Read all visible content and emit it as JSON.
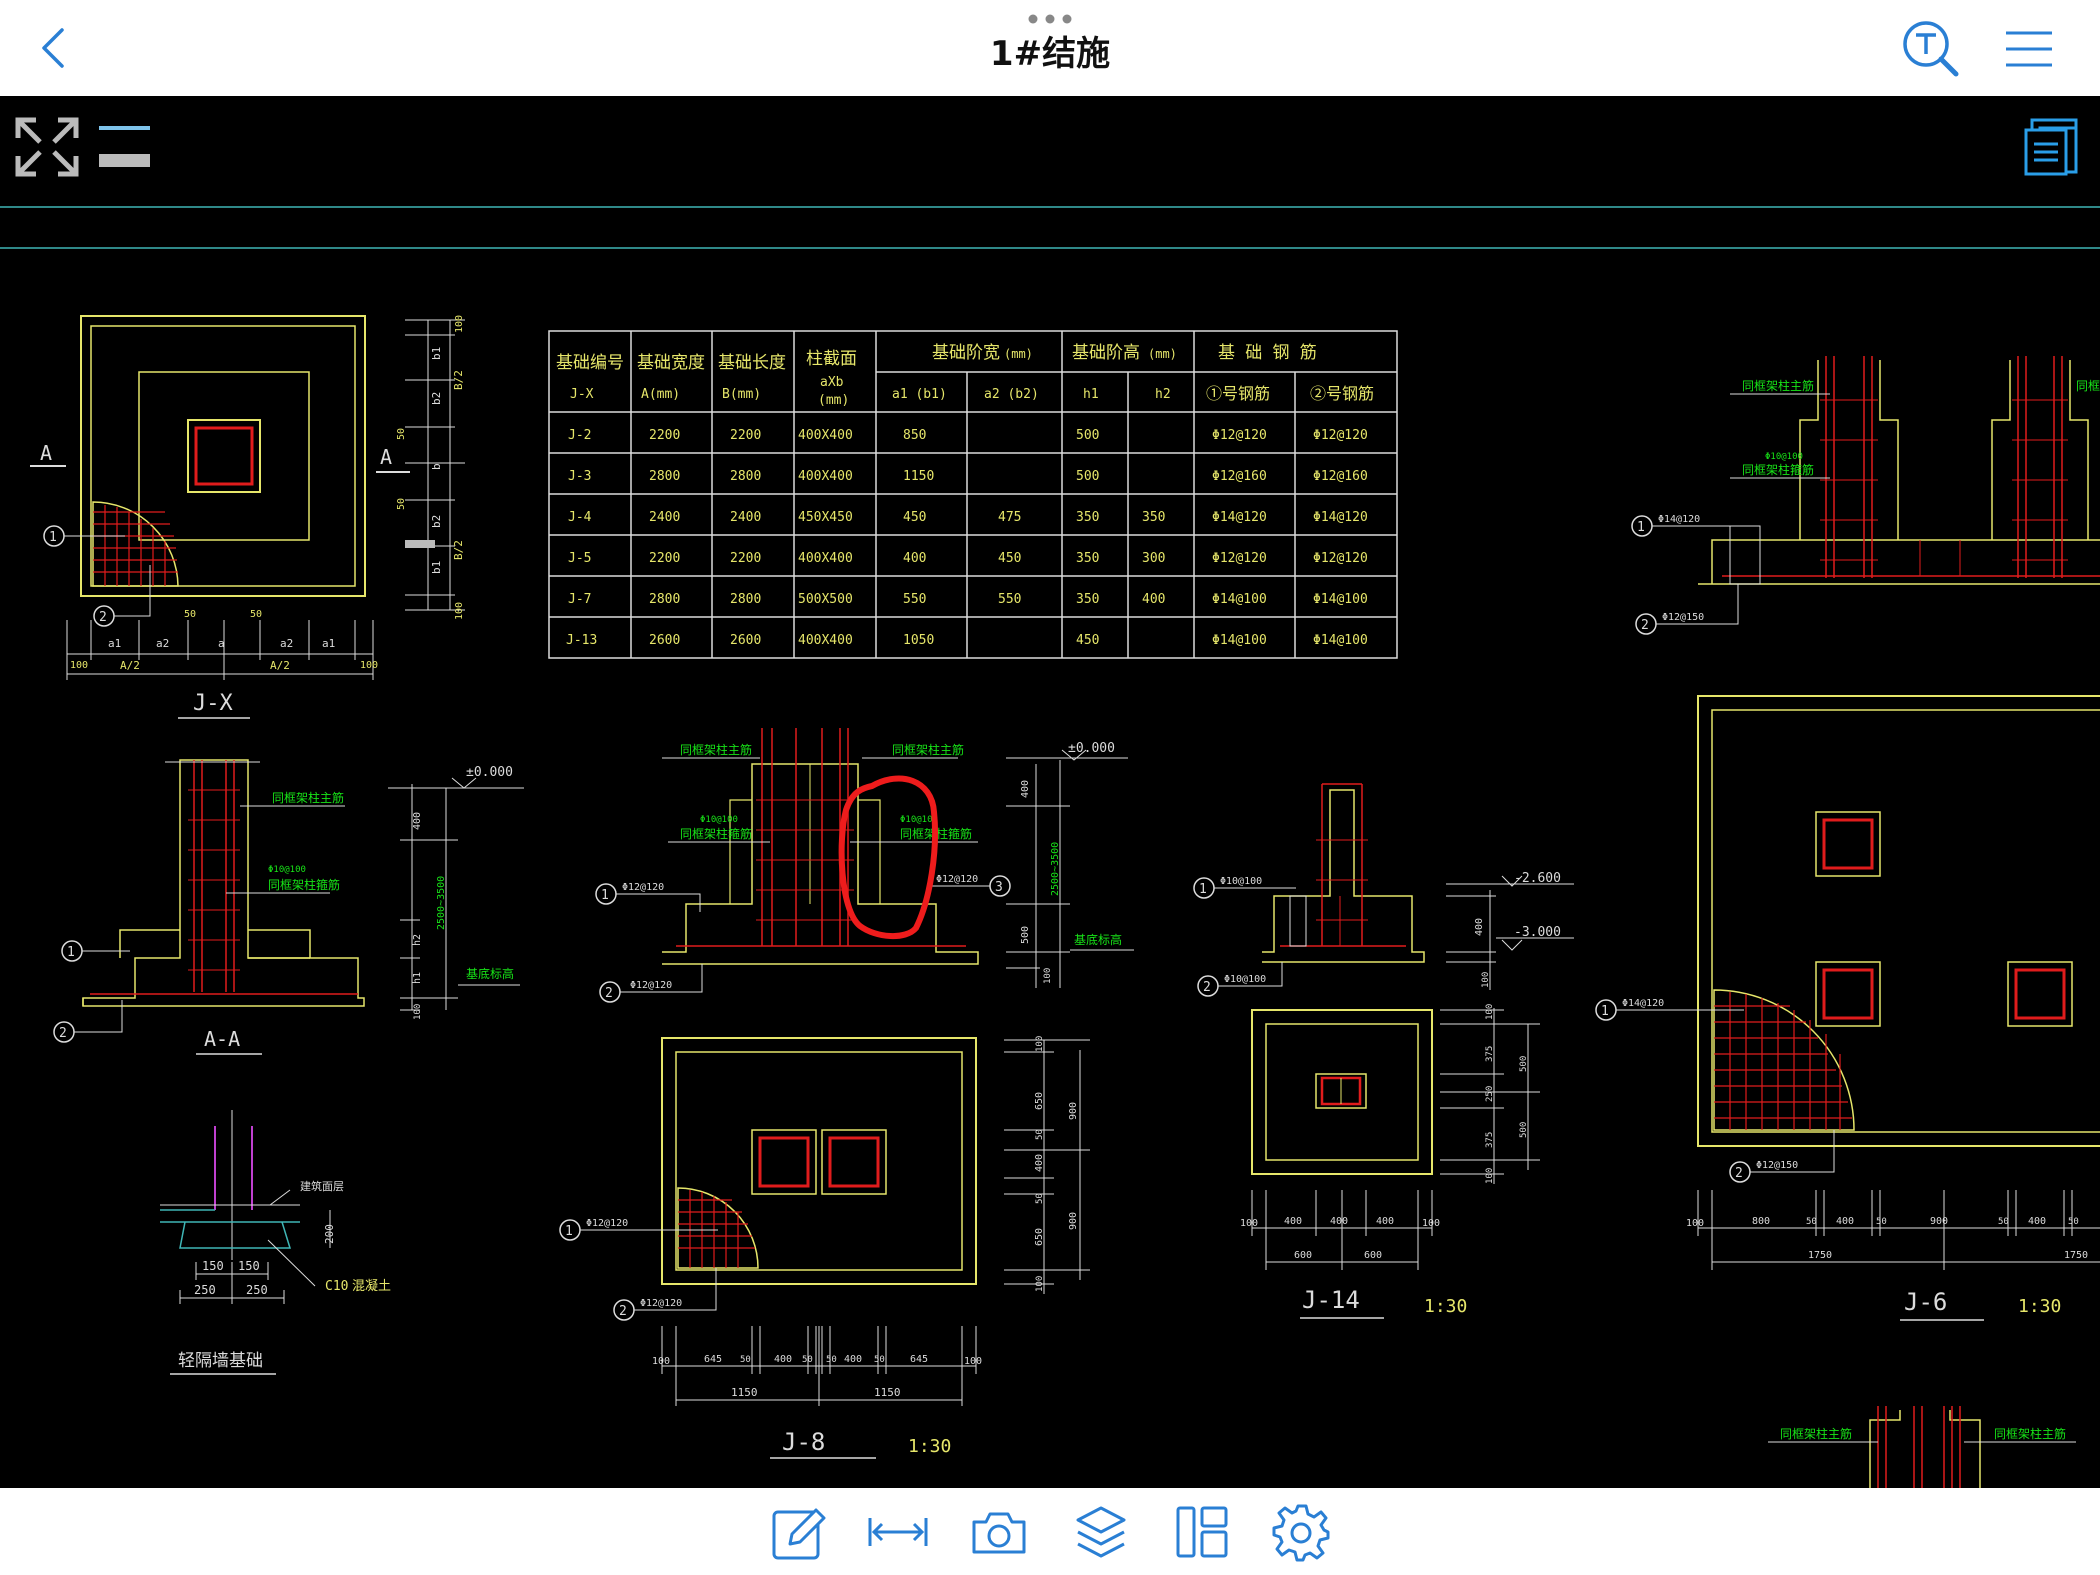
{
  "header": {
    "title": "1#结施"
  },
  "table": {
    "headers": [
      "基础编号",
      "基础宽度",
      "基础长度",
      "柱截面",
      "基础阶宽",
      "(mm)",
      "基础阶高",
      "(mm)",
      "基 础 钢 筋"
    ],
    "sub": [
      "J-X",
      "A(mm)",
      "B(mm)",
      "aXb",
      "(mm)",
      "a1 (b1)",
      "a2 (b2)",
      "h1",
      "h2",
      "①号钢筋",
      "②号钢筋"
    ],
    "rows": [
      [
        "J-2",
        "2200",
        "2200",
        "400X400",
        "850",
        "",
        "500",
        "",
        "Φ12@120",
        "Φ12@120"
      ],
      [
        "J-3",
        "2800",
        "2800",
        "400X400",
        "1150",
        "",
        "500",
        "",
        "Φ12@160",
        "Φ12@160"
      ],
      [
        "J-4",
        "2400",
        "2400",
        "450X450",
        "450",
        "475",
        "350",
        "350",
        "Φ14@120",
        "Φ14@120"
      ],
      [
        "J-5",
        "2200",
        "2200",
        "400X400",
        "400",
        "450",
        "350",
        "300",
        "Φ12@120",
        "Φ12@120"
      ],
      [
        "J-7",
        "2800",
        "2800",
        "500X500",
        "550",
        "550",
        "350",
        "400",
        "Φ14@100",
        "Φ14@100"
      ],
      [
        "J-13",
        "2600",
        "2600",
        "400X400",
        "1050",
        "",
        "450",
        "",
        "Φ14@100",
        "Φ14@100"
      ]
    ]
  },
  "labels": {
    "jx": "J-X",
    "aa": "A-A",
    "sec_a": "A",
    "light_wall": "轻隔墙基础",
    "j8": "J-8",
    "j14": "J-14",
    "j6": "J-6",
    "scale": "1:30",
    "c10": "C10",
    "concrete": "混凝土",
    "ground": "建筑面层",
    "col_main": "同框架柱主筋",
    "col_stir": "同框架柱箍筋",
    "base_level": "基底标高",
    "pm0": "±0.000",
    "m2600": "-2.600",
    "m3000": "-3.000",
    "r1": "Φ12@120",
    "r2": "Φ12@150",
    "r3": "Φ10@100",
    "r4": "Φ14@120",
    "dim_a2": "A/2",
    "dim_b2": "B/2",
    "range": "2500~3500",
    "a1": "a1",
    "a2": "a2",
    "a": "a",
    "b": "b",
    "b1": "b1",
    "b2": "b2",
    "h1": "h1",
    "h2": "h2",
    "j8_dims": [
      "100",
      "645",
      "50",
      "400",
      "50",
      "50",
      "400",
      "50",
      "645",
      "100"
    ],
    "j8_tot": [
      "1150",
      "1150"
    ],
    "j14_dims": [
      "100",
      "400",
      "400",
      "400",
      "100"
    ],
    "j14_tot": [
      "600",
      "600"
    ],
    "j6_dims": [
      "100",
      "800",
      "50",
      "400",
      "50",
      "900",
      "50",
      "400",
      "50"
    ],
    "j6_tot": [
      "1750",
      "1750"
    ],
    "lw_dims": [
      "150",
      "150",
      "250",
      "250",
      "200"
    ]
  },
  "colors": {
    "yellow": "#e6e66a",
    "green": "#17e317",
    "red": "#e01c1c",
    "cyan": "#3fb6b6",
    "accent": "#2a7fd4"
  }
}
